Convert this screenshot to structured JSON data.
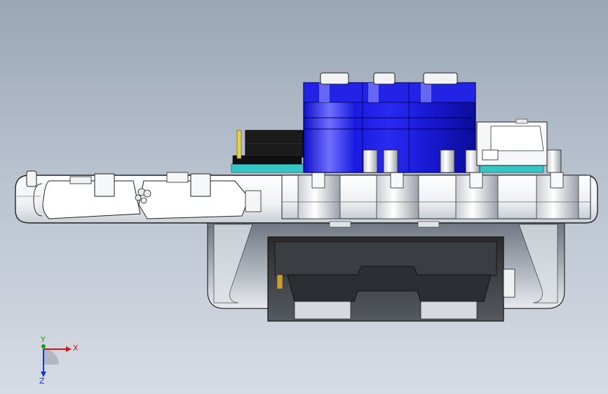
{
  "viewport": {
    "background_top": "#9aa6b6",
    "background_bottom": "#d6dce4"
  },
  "model": {
    "name": "",
    "colors": {
      "servo_blue": "#1a1ad8",
      "servo_blue_dark": "#0c0c9a",
      "servo_highlight": "#8f8fff",
      "body_white": "#f2f4f7",
      "body_outline": "#2a2a2a",
      "base_gray": "#7f8792",
      "base_gray_light": "#bcc2ca",
      "pcb_teal": "#35c6c6",
      "battery_black": "#1b1b1b",
      "pin_yellow": "#e6d24a"
    }
  },
  "triad": {
    "x_label": "X",
    "y_label": "Y",
    "z_label": "Z",
    "x_color": "#d01818",
    "y_color": "#18a018",
    "z_color": "#1838c8",
    "icon": "coordinate-triad-icon"
  }
}
